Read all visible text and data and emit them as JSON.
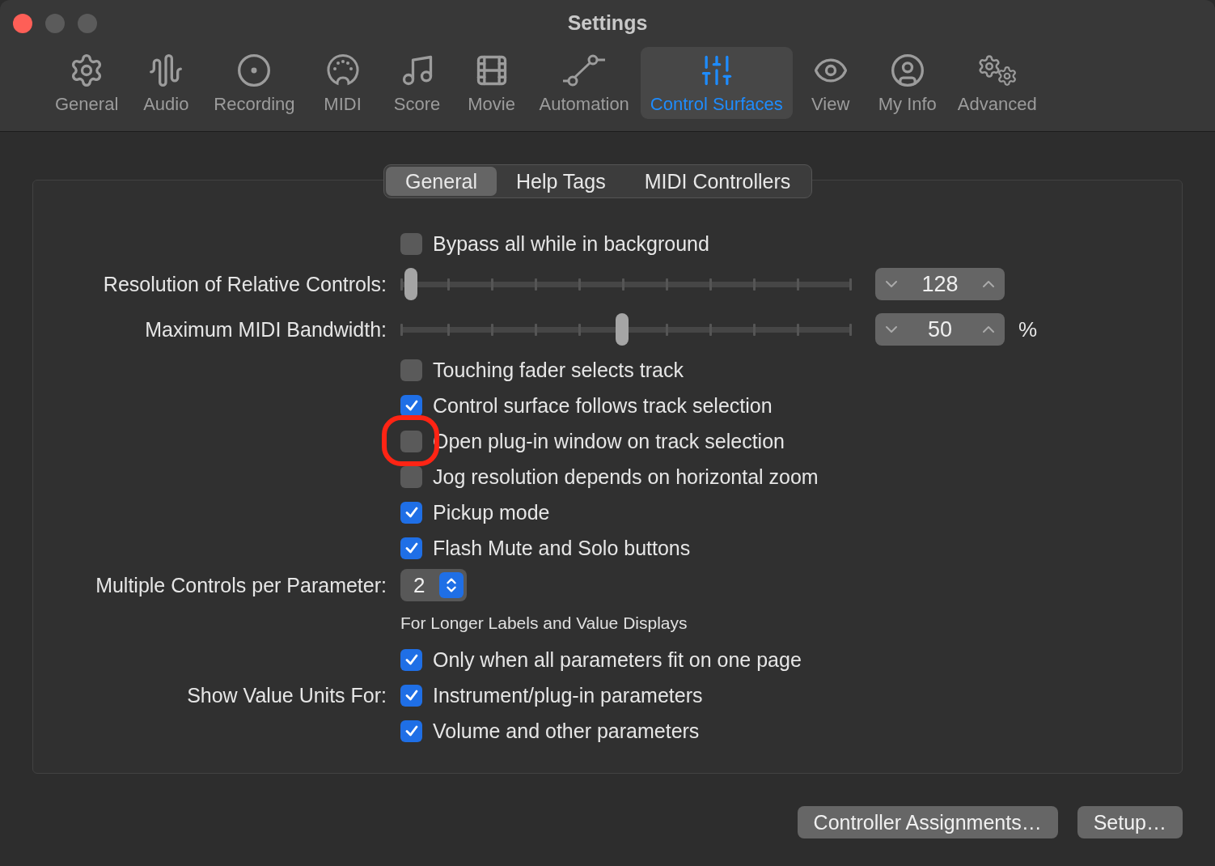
{
  "window": {
    "title": "Settings"
  },
  "toolbar": [
    {
      "label": "General",
      "selected": false
    },
    {
      "label": "Audio",
      "selected": false
    },
    {
      "label": "Recording",
      "selected": false
    },
    {
      "label": "MIDI",
      "selected": false
    },
    {
      "label": "Score",
      "selected": false
    },
    {
      "label": "Movie",
      "selected": false
    },
    {
      "label": "Automation",
      "selected": false
    },
    {
      "label": "Control Surfaces",
      "selected": true
    },
    {
      "label": "View",
      "selected": false
    },
    {
      "label": "My Info",
      "selected": false
    },
    {
      "label": "Advanced",
      "selected": false
    }
  ],
  "tabs": [
    {
      "label": "General",
      "selected": true
    },
    {
      "label": "Help Tags",
      "selected": false
    },
    {
      "label": "MIDI Controllers",
      "selected": false
    }
  ],
  "rows": [
    {
      "kind": "checkbox",
      "text": "Bypass all while in background",
      "checked": false
    },
    {
      "kind": "slider",
      "label": "Resolution of Relative Controls:",
      "level": 0.01,
      "value": "128"
    },
    {
      "kind": "slider",
      "label": "Maximum MIDI Bandwidth:",
      "level": 0.49,
      "value": "50",
      "unit": "%"
    },
    {
      "kind": "checkbox",
      "text": "Touching fader selects track",
      "checked": false
    },
    {
      "kind": "checkbox",
      "text": "Control surface follows track selection",
      "checked": true
    },
    {
      "kind": "checkbox",
      "text": "Open plug-in window on track selection",
      "checked": false,
      "highlighted": true
    },
    {
      "kind": "checkbox",
      "text": "Jog resolution depends on horizontal zoom",
      "checked": false
    },
    {
      "kind": "checkbox",
      "text": "Pickup mode",
      "checked": true
    },
    {
      "kind": "checkbox",
      "text": "Flash Mute and Solo buttons",
      "checked": true
    },
    {
      "kind": "popup",
      "label": "Multiple Controls per Parameter:",
      "value": "2"
    },
    {
      "kind": "note",
      "text": "For Longer Labels and Value Displays"
    },
    {
      "kind": "checkbox",
      "text": "Only when all parameters fit on one page",
      "checked": true
    },
    {
      "kind": "checkbox",
      "label": "Show Value Units For:",
      "text": "Instrument/plug-in parameters",
      "checked": true
    },
    {
      "kind": "checkbox",
      "text": "Volume and other parameters",
      "checked": true
    }
  ],
  "buttons": [
    "Controller Assignments…",
    "Setup…"
  ]
}
